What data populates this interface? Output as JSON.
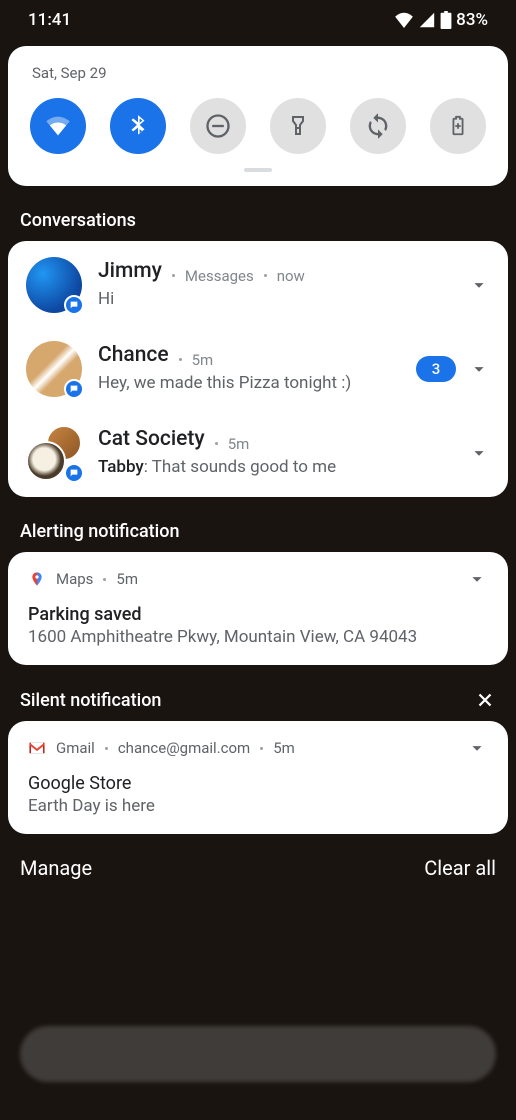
{
  "status": {
    "time": "11:41",
    "battery_pct": "83%"
  },
  "qs": {
    "date": "Sat, Sep 29",
    "tiles": [
      {
        "name": "wifi",
        "active": true
      },
      {
        "name": "bluetooth",
        "active": true
      },
      {
        "name": "dnd",
        "active": false
      },
      {
        "name": "flashlight",
        "active": false
      },
      {
        "name": "autorotate",
        "active": false
      },
      {
        "name": "battery-saver",
        "active": false
      }
    ]
  },
  "sections": {
    "conversations": "Conversations",
    "alerting": "Alerting notification",
    "silent": "Silent notification"
  },
  "conversations": [
    {
      "title": "Jimmy",
      "app": "Messages",
      "time": "now",
      "body": "Hi",
      "count": null,
      "badge_app": "messages"
    },
    {
      "title": "Chance",
      "app": null,
      "time": "5m",
      "body": "Hey, we made this Pizza tonight :)",
      "count": "3",
      "badge_app": "messages"
    },
    {
      "title": "Cat Society",
      "app": null,
      "time": "5m",
      "sender": "Tabby",
      "body": ": That sounds good to me",
      "count": null,
      "badge_app": "messages"
    }
  ],
  "alerting": {
    "app": "Maps",
    "time": "5m",
    "title": "Parking saved",
    "body": "1600 Amphitheatre Pkwy, Mountain View, CA 94043"
  },
  "silent": {
    "app": "Gmail",
    "account": "chance@gmail.com",
    "time": "5m",
    "title": "Google Store",
    "body": "Earth Day is here"
  },
  "footer": {
    "manage": "Manage",
    "clear": "Clear all"
  }
}
